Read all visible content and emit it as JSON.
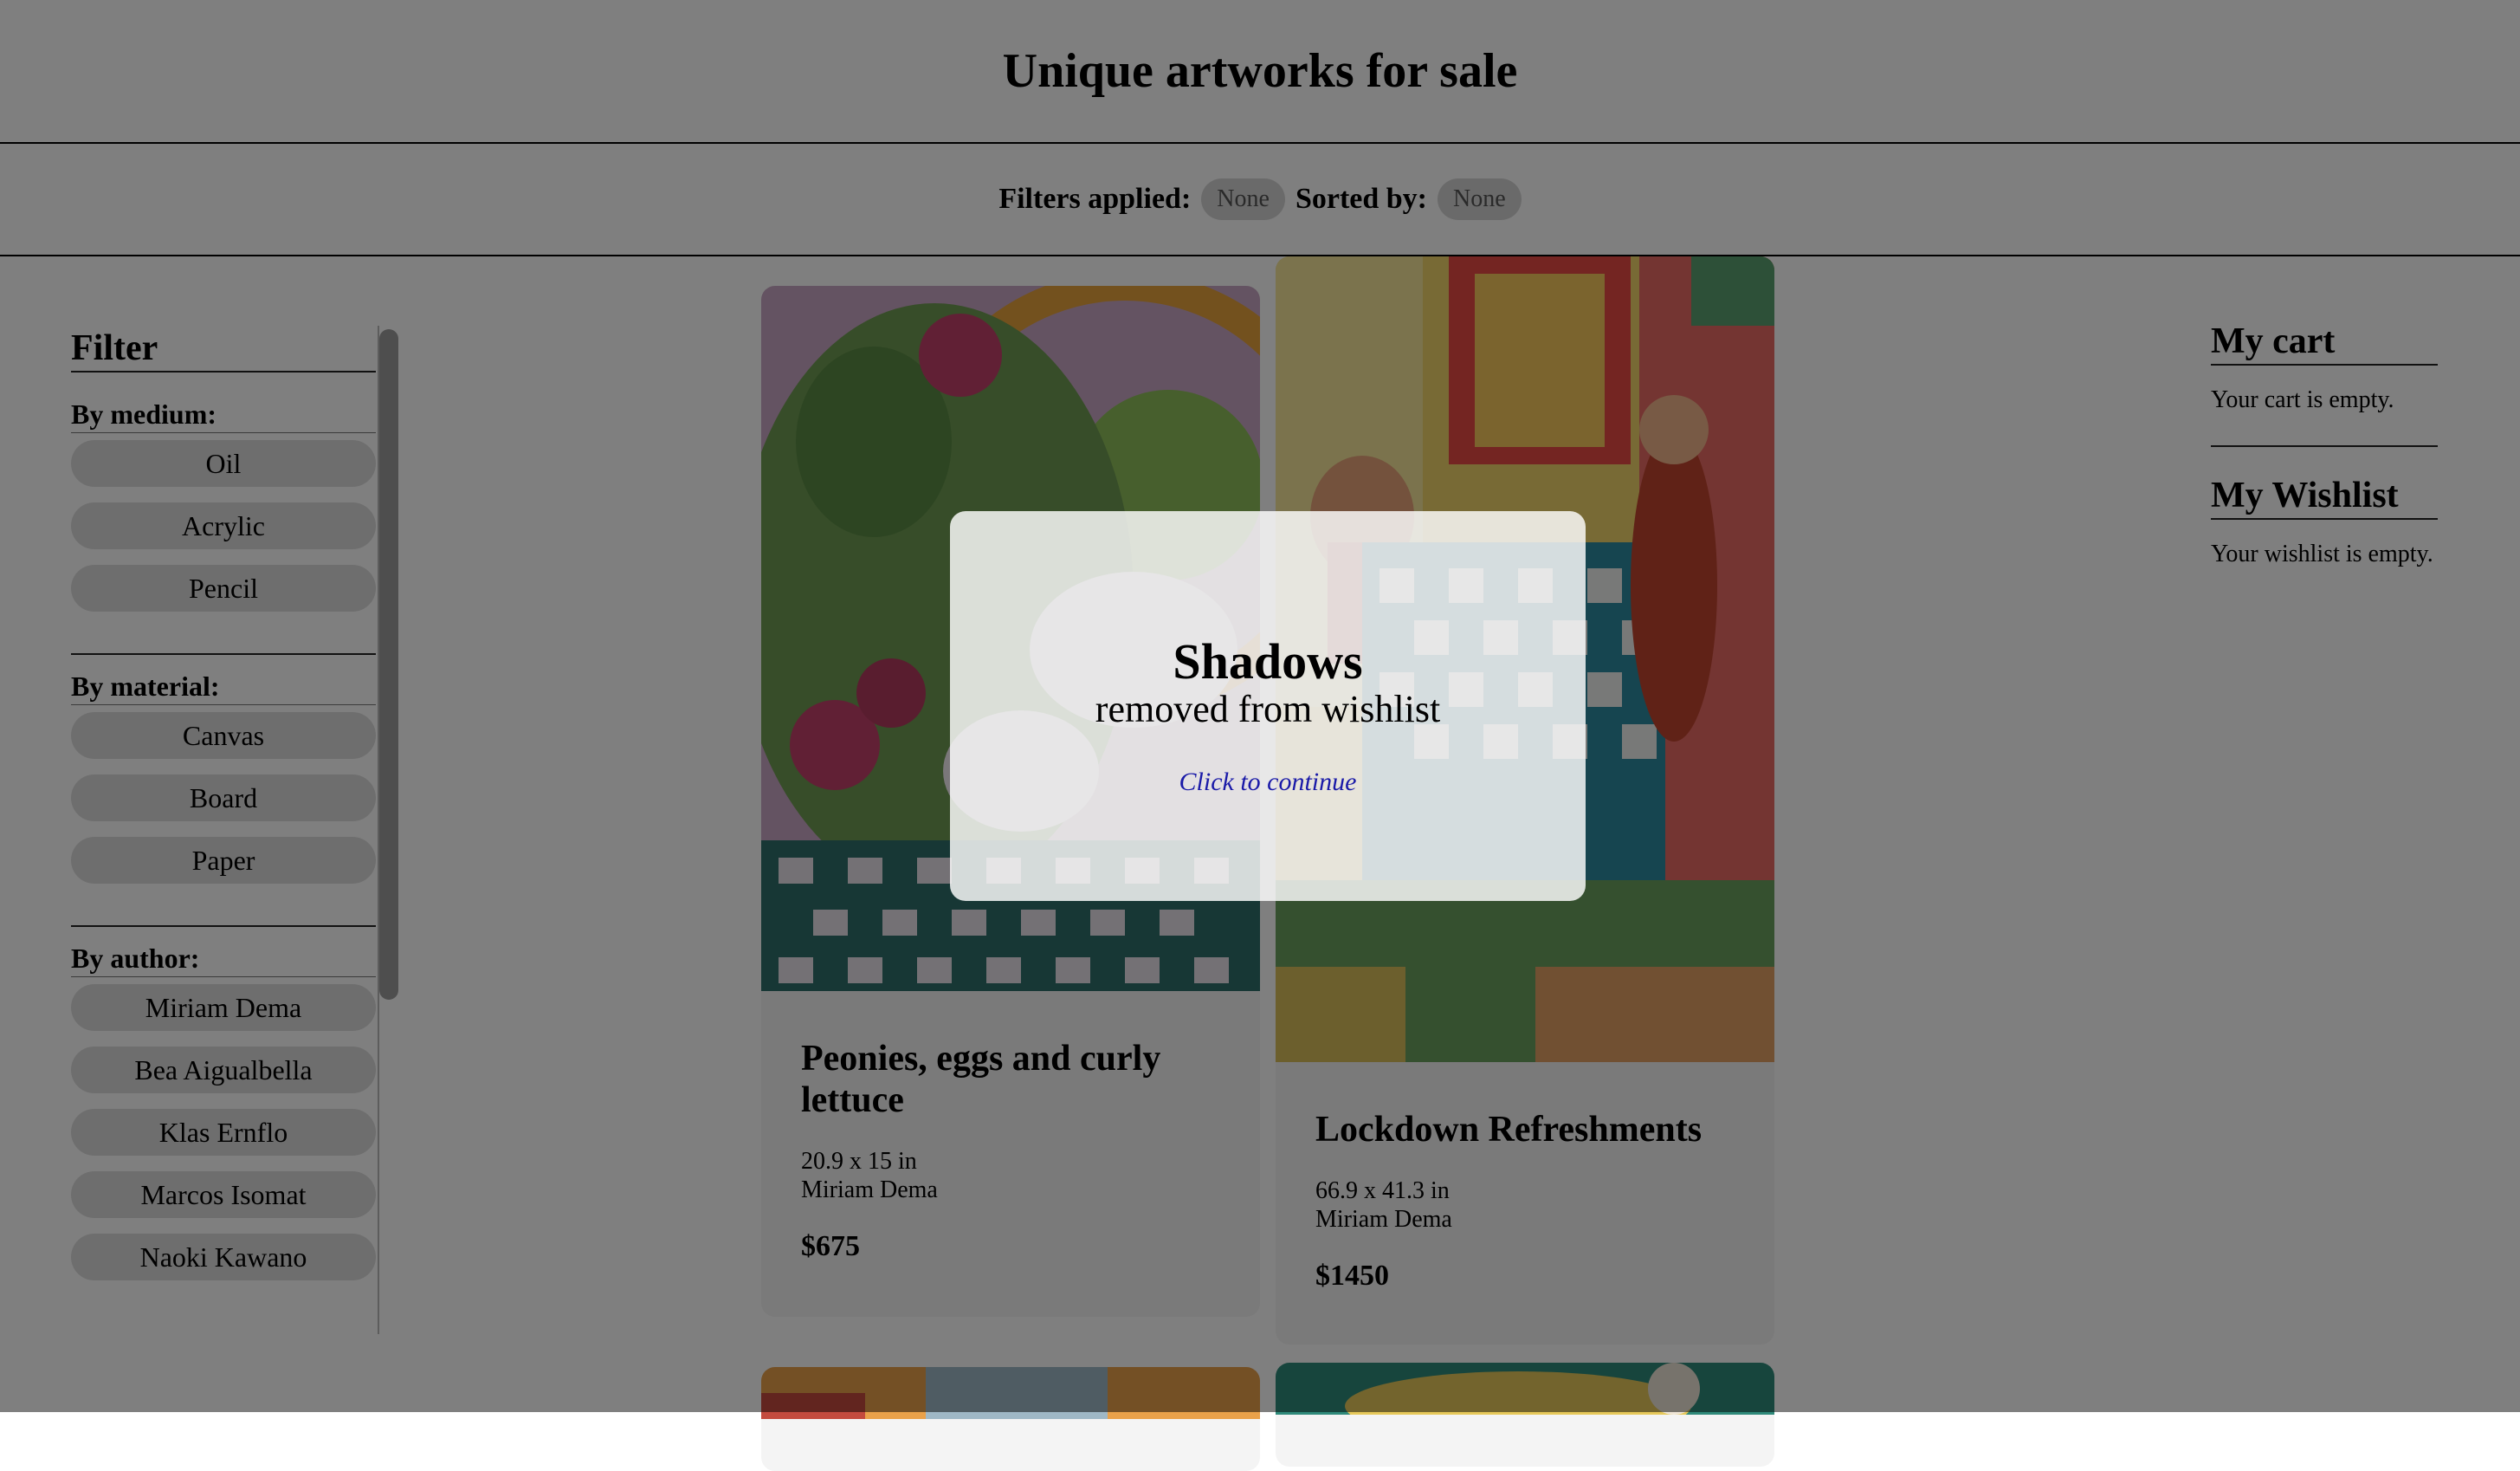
{
  "header": {
    "title": "Unique artworks for sale"
  },
  "filterbar": {
    "filters_label": "Filters applied:",
    "filters_value": "None",
    "sorted_label": "Sorted by:",
    "sorted_value": "None"
  },
  "sidebar": {
    "title": "Filter",
    "medium": {
      "label": "By medium:",
      "options": [
        "Oil",
        "Acrylic",
        "Pencil"
      ]
    },
    "material": {
      "label": "By material:",
      "options": [
        "Canvas",
        "Board",
        "Paper"
      ]
    },
    "author": {
      "label": "By author:",
      "options": [
        "Miriam Dema",
        "Bea Aigualbella",
        "Klas Ernflo",
        "Marcos Isomat",
        "Naoki Kawano"
      ]
    }
  },
  "artworks": [
    {
      "title": "Peonies, eggs and curly lettuce",
      "size": "20.9 x 15 in",
      "author": "Miriam Dema",
      "price": "$675"
    },
    {
      "title": "Lockdown Refreshments",
      "size": "66.9 x 41.3 in",
      "author": "Miriam Dema",
      "price": "$1450"
    }
  ],
  "cart": {
    "title": "My cart",
    "empty": "Your cart is empty."
  },
  "wishlist": {
    "title": "My Wishlist",
    "empty": "Your wishlist is empty."
  },
  "modal": {
    "title": "Shadows",
    "subtitle": "removed from wishlist",
    "link": "Click to continue"
  },
  "colors": {
    "overlay": "#808080",
    "link": "#1a1aa8"
  }
}
